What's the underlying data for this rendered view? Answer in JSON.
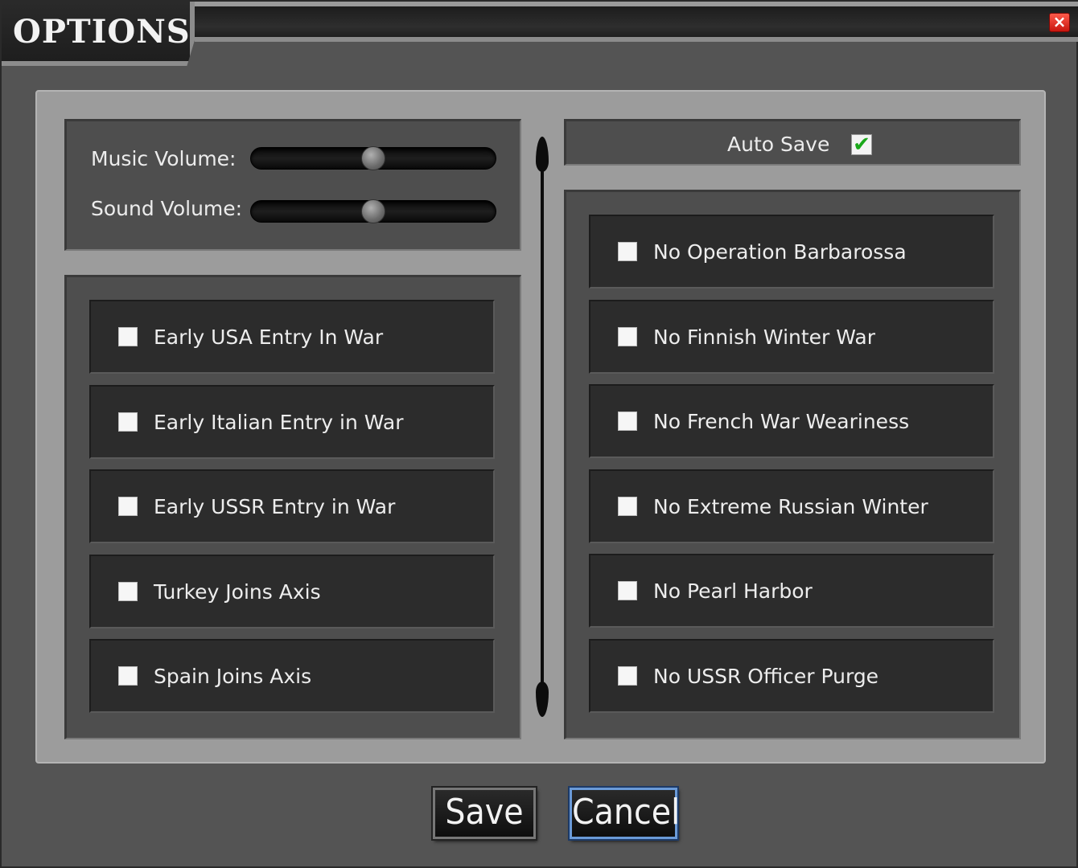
{
  "window": {
    "title": "OPTIONS",
    "close_icon": "×"
  },
  "audio": {
    "music_label": "Music Volume:",
    "music_level": 0.5,
    "sound_label": "Sound Volume:",
    "sound_level": 0.5
  },
  "autosave": {
    "label": "Auto Save",
    "checked": true,
    "check_glyph": "✔"
  },
  "left_options": [
    {
      "label": "Early USA Entry In War",
      "checked": false
    },
    {
      "label": "Early Italian Entry in War",
      "checked": false
    },
    {
      "label": "Early USSR Entry in War",
      "checked": false
    },
    {
      "label": "Turkey Joins Axis",
      "checked": false
    },
    {
      "label": "Spain Joins Axis",
      "checked": false
    }
  ],
  "right_options": [
    {
      "label": "No Operation Barbarossa",
      "checked": false
    },
    {
      "label": "No Finnish Winter War",
      "checked": false
    },
    {
      "label": "No French War Weariness",
      "checked": false
    },
    {
      "label": "No Extreme Russian Winter",
      "checked": false
    },
    {
      "label": "No Pearl Harbor",
      "checked": false
    },
    {
      "label": "No USSR Officer Purge",
      "checked": false
    }
  ],
  "buttons": {
    "save": "Save",
    "cancel": "Cancel"
  }
}
